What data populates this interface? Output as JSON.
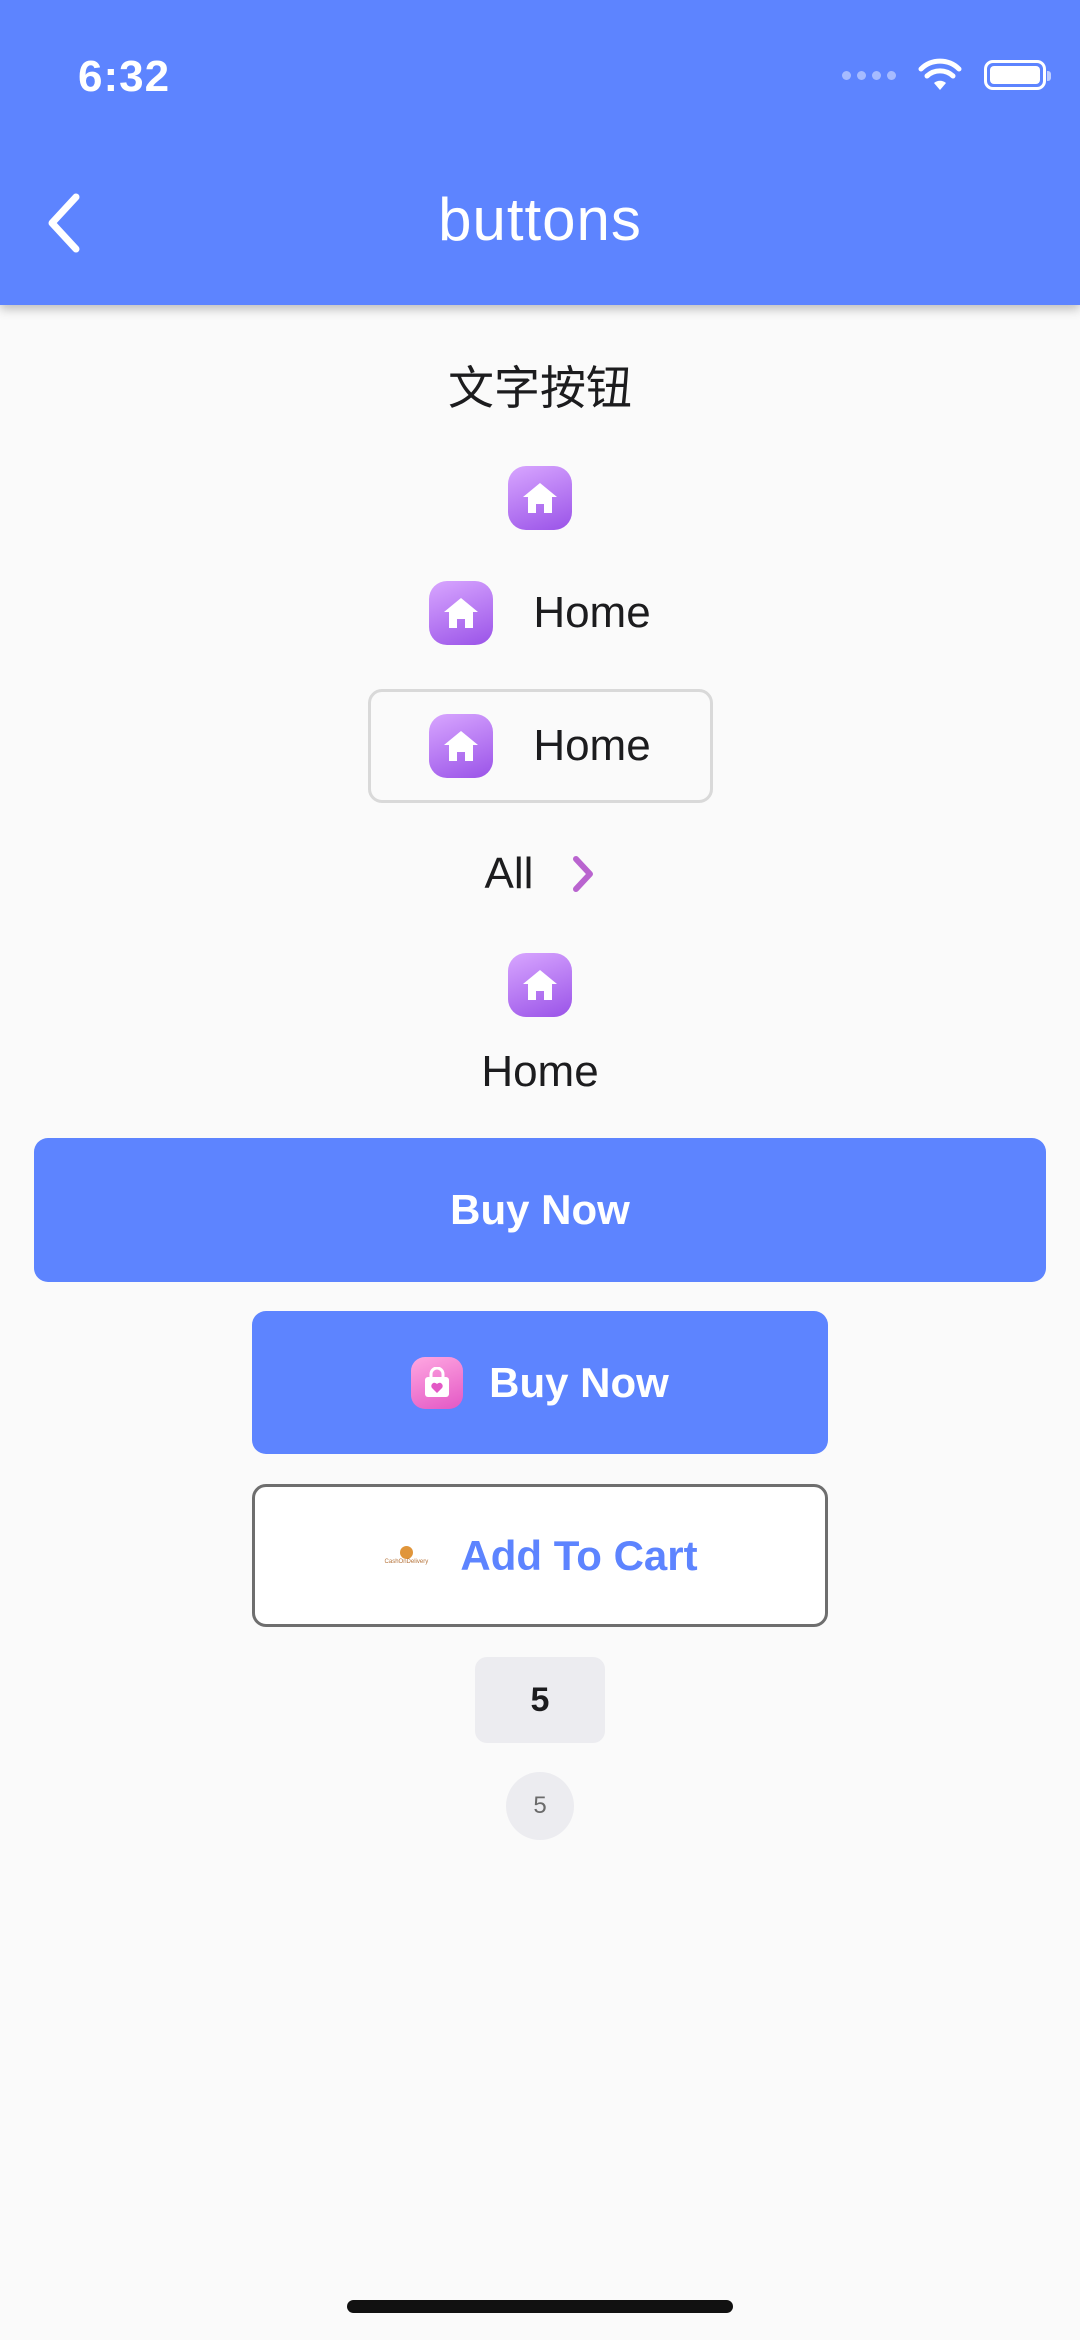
{
  "status_bar": {
    "time": "6:32"
  },
  "app_bar": {
    "title": "buttons"
  },
  "buttons": {
    "text_button_label": "文字按钮",
    "icon_text_label": "Home",
    "outlined_icon_text_label": "Home",
    "all_label": "All",
    "column_icon_label": "Home",
    "buy_now_wide_label": "Buy Now",
    "buy_now_icon_label": "Buy Now",
    "add_to_cart_label": "Add To Cart",
    "count_chip_value": "5",
    "count_circle_value": "5"
  },
  "cod_logo_text": "CashOnDelivery",
  "colors": {
    "primary": "#5d84ff",
    "home_icon_gradient": [
      "#d8a6ff",
      "#9a53e8"
    ],
    "bag_icon_gradient": [
      "#ffa7e1",
      "#e358c5"
    ],
    "chevron": "#b964cf"
  }
}
